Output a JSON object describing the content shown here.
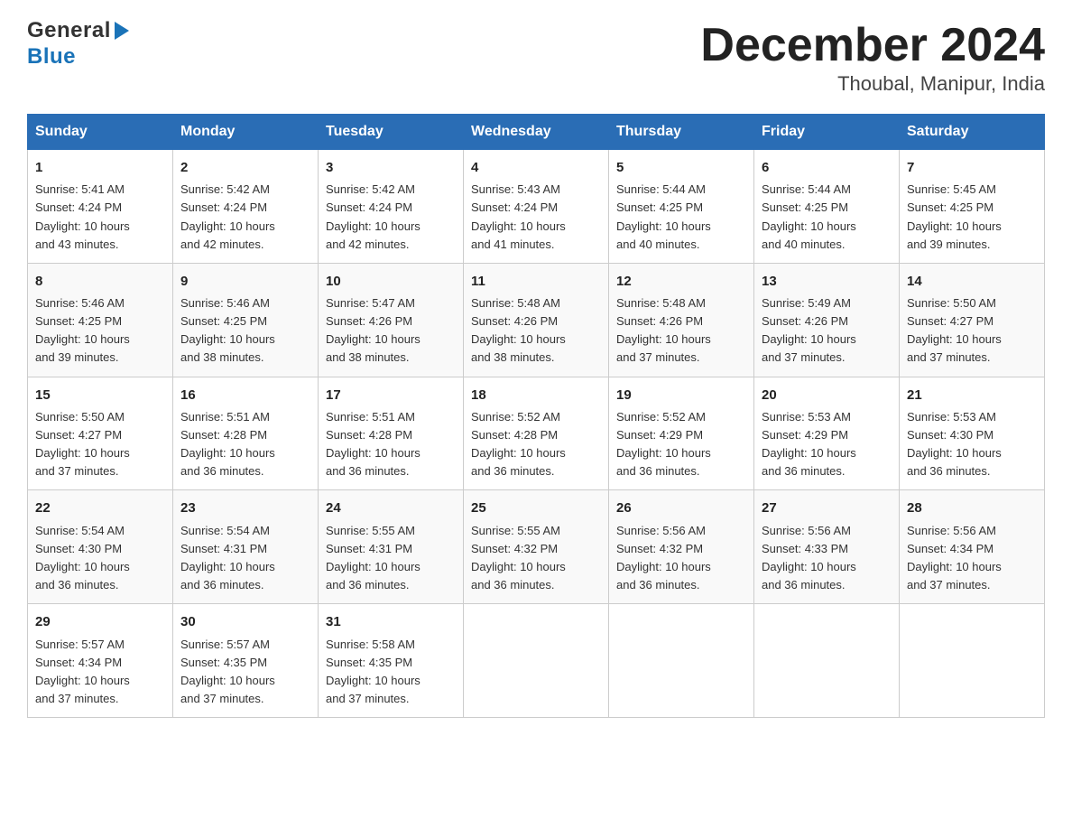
{
  "header": {
    "logo_line1": "General",
    "logo_line2": "Blue",
    "month_title": "December 2024",
    "location": "Thoubal, Manipur, India"
  },
  "days_of_week": [
    "Sunday",
    "Monday",
    "Tuesday",
    "Wednesday",
    "Thursday",
    "Friday",
    "Saturday"
  ],
  "weeks": [
    [
      {
        "day": "1",
        "sunrise": "5:41 AM",
        "sunset": "4:24 PM",
        "daylight": "10 hours and 43 minutes."
      },
      {
        "day": "2",
        "sunrise": "5:42 AM",
        "sunset": "4:24 PM",
        "daylight": "10 hours and 42 minutes."
      },
      {
        "day": "3",
        "sunrise": "5:42 AM",
        "sunset": "4:24 PM",
        "daylight": "10 hours and 42 minutes."
      },
      {
        "day": "4",
        "sunrise": "5:43 AM",
        "sunset": "4:24 PM",
        "daylight": "10 hours and 41 minutes."
      },
      {
        "day": "5",
        "sunrise": "5:44 AM",
        "sunset": "4:25 PM",
        "daylight": "10 hours and 40 minutes."
      },
      {
        "day": "6",
        "sunrise": "5:44 AM",
        "sunset": "4:25 PM",
        "daylight": "10 hours and 40 minutes."
      },
      {
        "day": "7",
        "sunrise": "5:45 AM",
        "sunset": "4:25 PM",
        "daylight": "10 hours and 39 minutes."
      }
    ],
    [
      {
        "day": "8",
        "sunrise": "5:46 AM",
        "sunset": "4:25 PM",
        "daylight": "10 hours and 39 minutes."
      },
      {
        "day": "9",
        "sunrise": "5:46 AM",
        "sunset": "4:25 PM",
        "daylight": "10 hours and 38 minutes."
      },
      {
        "day": "10",
        "sunrise": "5:47 AM",
        "sunset": "4:26 PM",
        "daylight": "10 hours and 38 minutes."
      },
      {
        "day": "11",
        "sunrise": "5:48 AM",
        "sunset": "4:26 PM",
        "daylight": "10 hours and 38 minutes."
      },
      {
        "day": "12",
        "sunrise": "5:48 AM",
        "sunset": "4:26 PM",
        "daylight": "10 hours and 37 minutes."
      },
      {
        "day": "13",
        "sunrise": "5:49 AM",
        "sunset": "4:26 PM",
        "daylight": "10 hours and 37 minutes."
      },
      {
        "day": "14",
        "sunrise": "5:50 AM",
        "sunset": "4:27 PM",
        "daylight": "10 hours and 37 minutes."
      }
    ],
    [
      {
        "day": "15",
        "sunrise": "5:50 AM",
        "sunset": "4:27 PM",
        "daylight": "10 hours and 37 minutes."
      },
      {
        "day": "16",
        "sunrise": "5:51 AM",
        "sunset": "4:28 PM",
        "daylight": "10 hours and 36 minutes."
      },
      {
        "day": "17",
        "sunrise": "5:51 AM",
        "sunset": "4:28 PM",
        "daylight": "10 hours and 36 minutes."
      },
      {
        "day": "18",
        "sunrise": "5:52 AM",
        "sunset": "4:28 PM",
        "daylight": "10 hours and 36 minutes."
      },
      {
        "day": "19",
        "sunrise": "5:52 AM",
        "sunset": "4:29 PM",
        "daylight": "10 hours and 36 minutes."
      },
      {
        "day": "20",
        "sunrise": "5:53 AM",
        "sunset": "4:29 PM",
        "daylight": "10 hours and 36 minutes."
      },
      {
        "day": "21",
        "sunrise": "5:53 AM",
        "sunset": "4:30 PM",
        "daylight": "10 hours and 36 minutes."
      }
    ],
    [
      {
        "day": "22",
        "sunrise": "5:54 AM",
        "sunset": "4:30 PM",
        "daylight": "10 hours and 36 minutes."
      },
      {
        "day": "23",
        "sunrise": "5:54 AM",
        "sunset": "4:31 PM",
        "daylight": "10 hours and 36 minutes."
      },
      {
        "day": "24",
        "sunrise": "5:55 AM",
        "sunset": "4:31 PM",
        "daylight": "10 hours and 36 minutes."
      },
      {
        "day": "25",
        "sunrise": "5:55 AM",
        "sunset": "4:32 PM",
        "daylight": "10 hours and 36 minutes."
      },
      {
        "day": "26",
        "sunrise": "5:56 AM",
        "sunset": "4:32 PM",
        "daylight": "10 hours and 36 minutes."
      },
      {
        "day": "27",
        "sunrise": "5:56 AM",
        "sunset": "4:33 PM",
        "daylight": "10 hours and 36 minutes."
      },
      {
        "day": "28",
        "sunrise": "5:56 AM",
        "sunset": "4:34 PM",
        "daylight": "10 hours and 37 minutes."
      }
    ],
    [
      {
        "day": "29",
        "sunrise": "5:57 AM",
        "sunset": "4:34 PM",
        "daylight": "10 hours and 37 minutes."
      },
      {
        "day": "30",
        "sunrise": "5:57 AM",
        "sunset": "4:35 PM",
        "daylight": "10 hours and 37 minutes."
      },
      {
        "day": "31",
        "sunrise": "5:58 AM",
        "sunset": "4:35 PM",
        "daylight": "10 hours and 37 minutes."
      },
      null,
      null,
      null,
      null
    ]
  ],
  "labels": {
    "sunrise": "Sunrise:",
    "sunset": "Sunset:",
    "daylight": "Daylight:"
  }
}
